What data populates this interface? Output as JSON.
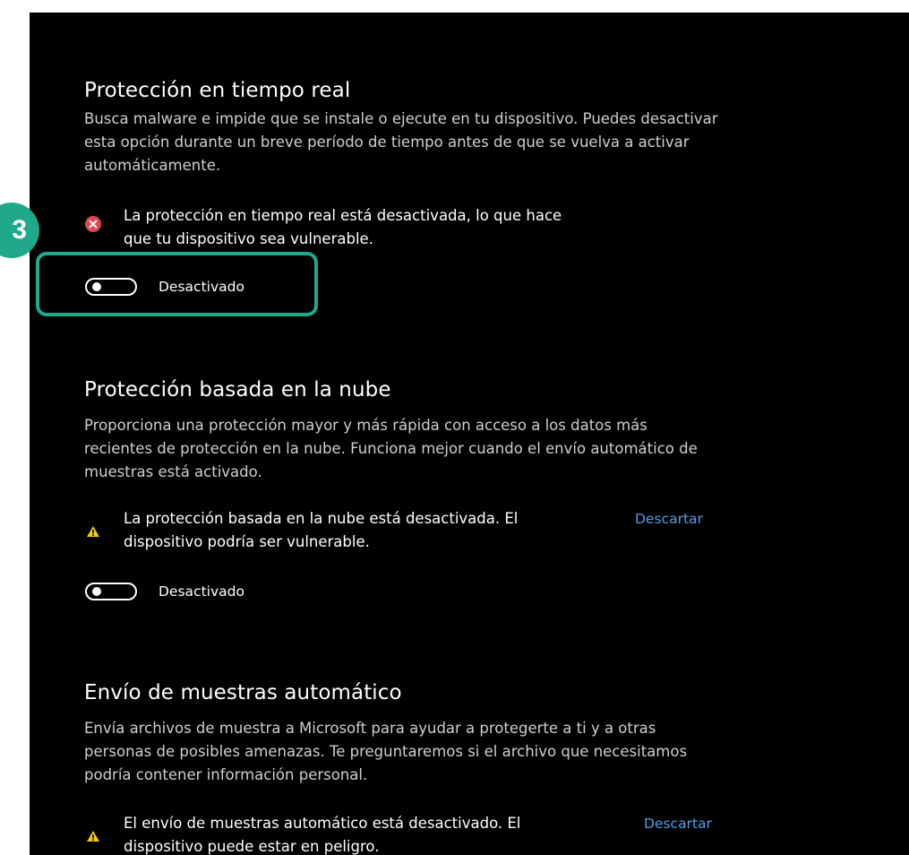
{
  "sections": [
    {
      "title": "Protección en tiempo real",
      "description": "Busca malware e impide que se instale o ejecute en tu dispositivo. Puedes desactivar esta opción durante un breve período de tiempo antes de que se vuelva a activar automáticamente.",
      "alert": {
        "icon": "error-circle-icon",
        "text": "La protección en tiempo real está desactivada, lo que hace que tu dispositivo sea vulnerable."
      },
      "toggle": {
        "state": "off",
        "label": "Desactivado"
      }
    },
    {
      "title": "Protección basada en la nube",
      "description": "Proporciona una protección mayor y más rápida con acceso a los datos más recientes de protección en la nube. Funciona mejor cuando el envío automático de muestras está activado.",
      "alert": {
        "icon": "warning-icon",
        "text": "La protección basada en la nube está desactivada. El dispositivo podría ser vulnerable.",
        "dismiss_label": "Descartar"
      },
      "toggle": {
        "state": "off",
        "label": "Desactivado"
      }
    },
    {
      "title": "Envío de muestras automático",
      "description": "Envía archivos de muestra a Microsoft para ayudar a protegerte a ti y a otras personas de posibles amenazas. Te preguntaremos si el archivo que necesitamos podría contener información personal.",
      "alert": {
        "icon": "warning-icon",
        "text": "El envío de muestras automático está desactivado. El dispositivo puede estar en peligro.",
        "dismiss_label": "Descartar"
      }
    }
  ],
  "annotation": {
    "step_number": "3"
  },
  "colors": {
    "background": "#000000",
    "text": "#ffffff",
    "link": "#4d9fea",
    "error": "#e0454f",
    "warning": "#f2c811",
    "highlight": "#1fa88a"
  }
}
